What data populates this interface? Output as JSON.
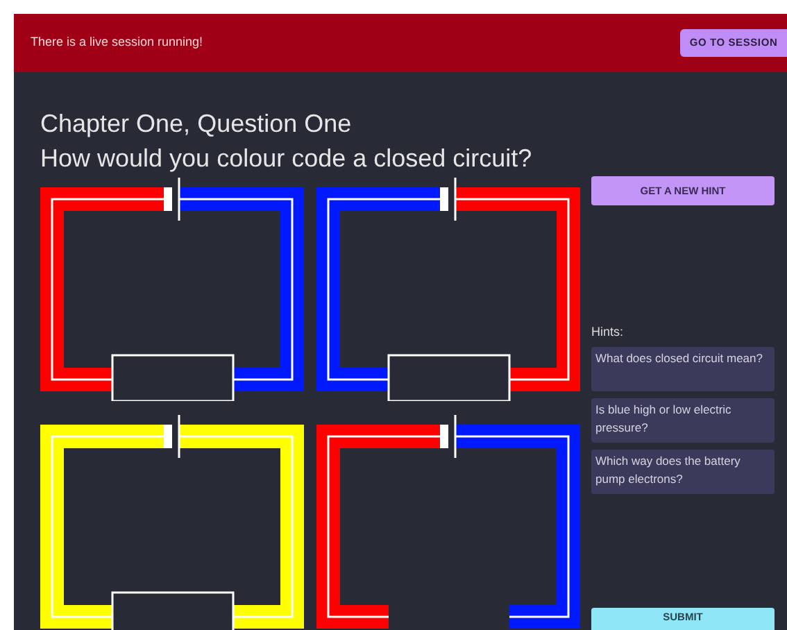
{
  "banner": {
    "message": "There is a live session running!",
    "button": "GO TO SESSION"
  },
  "chapter": "Chapter One, Question One",
  "question": "How would you colour code a closed circuit?",
  "circuits": [
    {
      "kind": "closed",
      "wires": [
        {
          "color": "#ff0000"
        },
        {
          "color": "#0019ff"
        }
      ]
    },
    {
      "kind": "closed",
      "wires": [
        {
          "color": "#0019ff"
        },
        {
          "color": "#ff0000"
        }
      ]
    },
    {
      "kind": "closed",
      "wires": [
        {
          "color": "#ffff00"
        },
        {
          "color": "#ffff00"
        }
      ]
    },
    {
      "kind": "open",
      "wires": [
        {
          "color": "#ff0000"
        },
        {
          "color": "#0019ff"
        }
      ]
    }
  ],
  "hint_button": "GET A NEW HINT",
  "hints_label": "Hints:",
  "hints": [
    "What does closed circuit mean?",
    "Is blue high or low electric pressure?",
    "Which way does the battery pump electrons?"
  ],
  "submit": "SUBMIT"
}
